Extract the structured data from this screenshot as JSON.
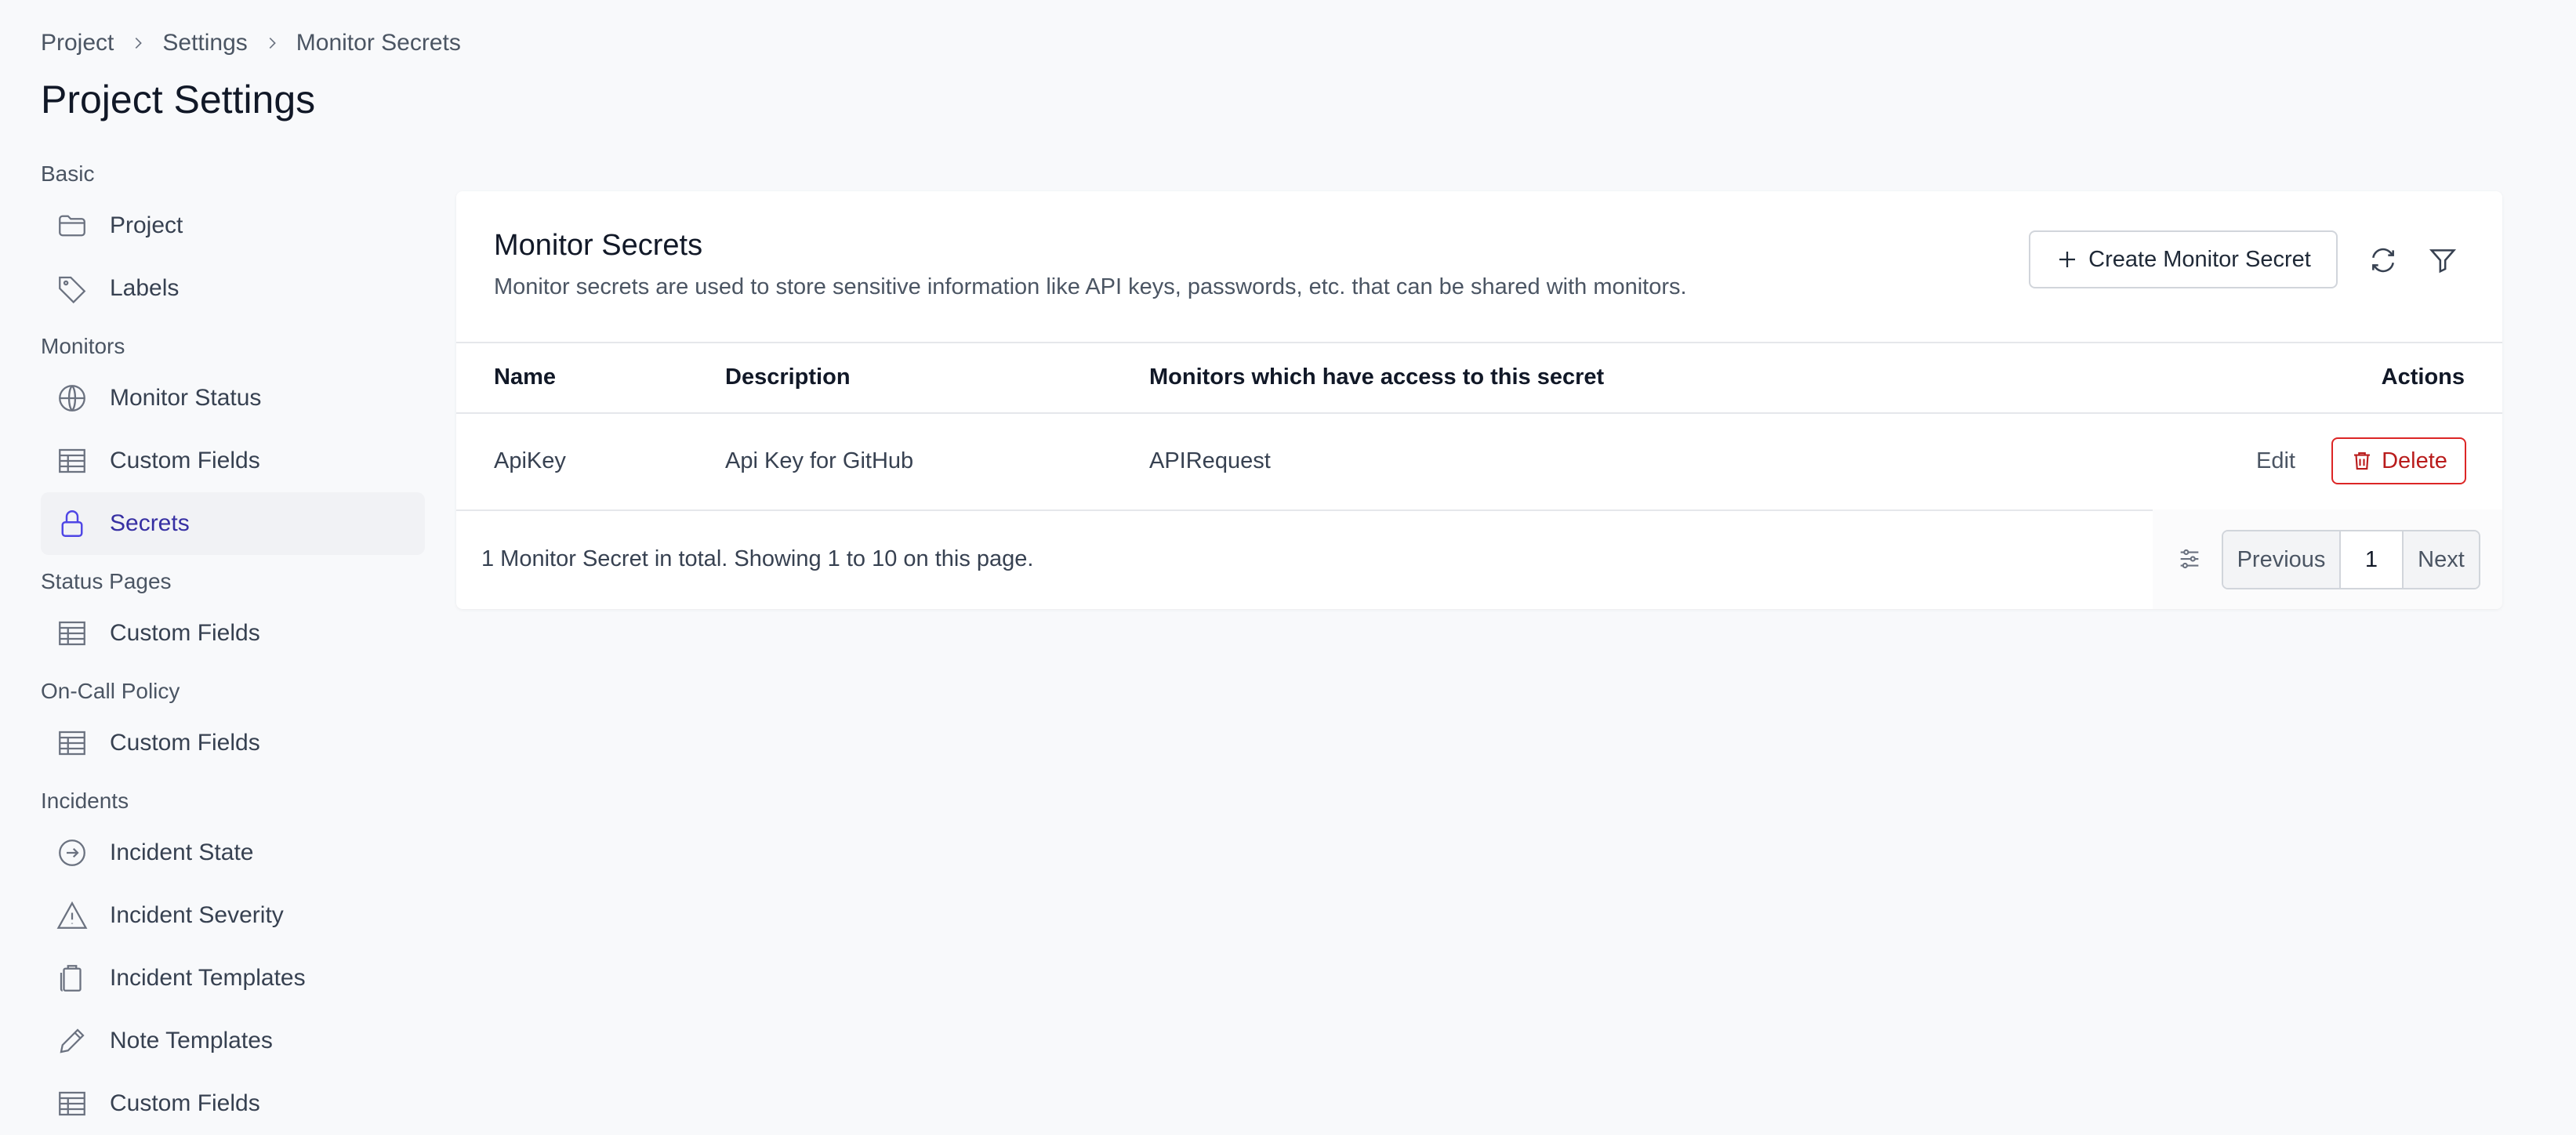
{
  "breadcrumb": [
    "Project",
    "Settings",
    "Monitor Secrets"
  ],
  "page_title": "Project Settings",
  "sidebar": {
    "sections": [
      {
        "title": "Basic",
        "items": [
          {
            "label": "Project",
            "icon": "folder-icon"
          },
          {
            "label": "Labels",
            "icon": "tag-icon"
          }
        ]
      },
      {
        "title": "Monitors",
        "items": [
          {
            "label": "Monitor Status",
            "icon": "globe-icon"
          },
          {
            "label": "Custom Fields",
            "icon": "table-icon"
          },
          {
            "label": "Secrets",
            "icon": "lock-icon",
            "active": true
          }
        ]
      },
      {
        "title": "Status Pages",
        "items": [
          {
            "label": "Custom Fields",
            "icon": "table-icon"
          }
        ]
      },
      {
        "title": "On-Call Policy",
        "items": [
          {
            "label": "Custom Fields",
            "icon": "table-icon"
          }
        ]
      },
      {
        "title": "Incidents",
        "items": [
          {
            "label": "Incident State",
            "icon": "arrow-circle-icon"
          },
          {
            "label": "Incident Severity",
            "icon": "warning-icon"
          },
          {
            "label": "Incident Templates",
            "icon": "clipboard-icon"
          },
          {
            "label": "Note Templates",
            "icon": "pencil-icon"
          },
          {
            "label": "Custom Fields",
            "icon": "table-icon"
          }
        ]
      }
    ]
  },
  "card": {
    "title": "Monitor Secrets",
    "description": "Monitor secrets are used to store sensitive information like API keys, passwords, etc. that can be shared with monitors.",
    "create_button": "Create Monitor Secret",
    "columns": [
      "Name",
      "Description",
      "Monitors which have access to this secret",
      "Actions"
    ],
    "rows": [
      {
        "name": "ApiKey",
        "description": "Api Key for GitHub",
        "monitors": "APIRequest",
        "edit": "Edit",
        "delete": "Delete"
      }
    ],
    "footer_text": "1 Monitor Secret in total. Showing 1 to 10 on this page.",
    "pagination": {
      "previous": "Previous",
      "page": "1",
      "next": "Next"
    }
  },
  "colors": {
    "accent": "#4f46e5",
    "danger": "#dc2626",
    "background": "#f8f9fb"
  }
}
